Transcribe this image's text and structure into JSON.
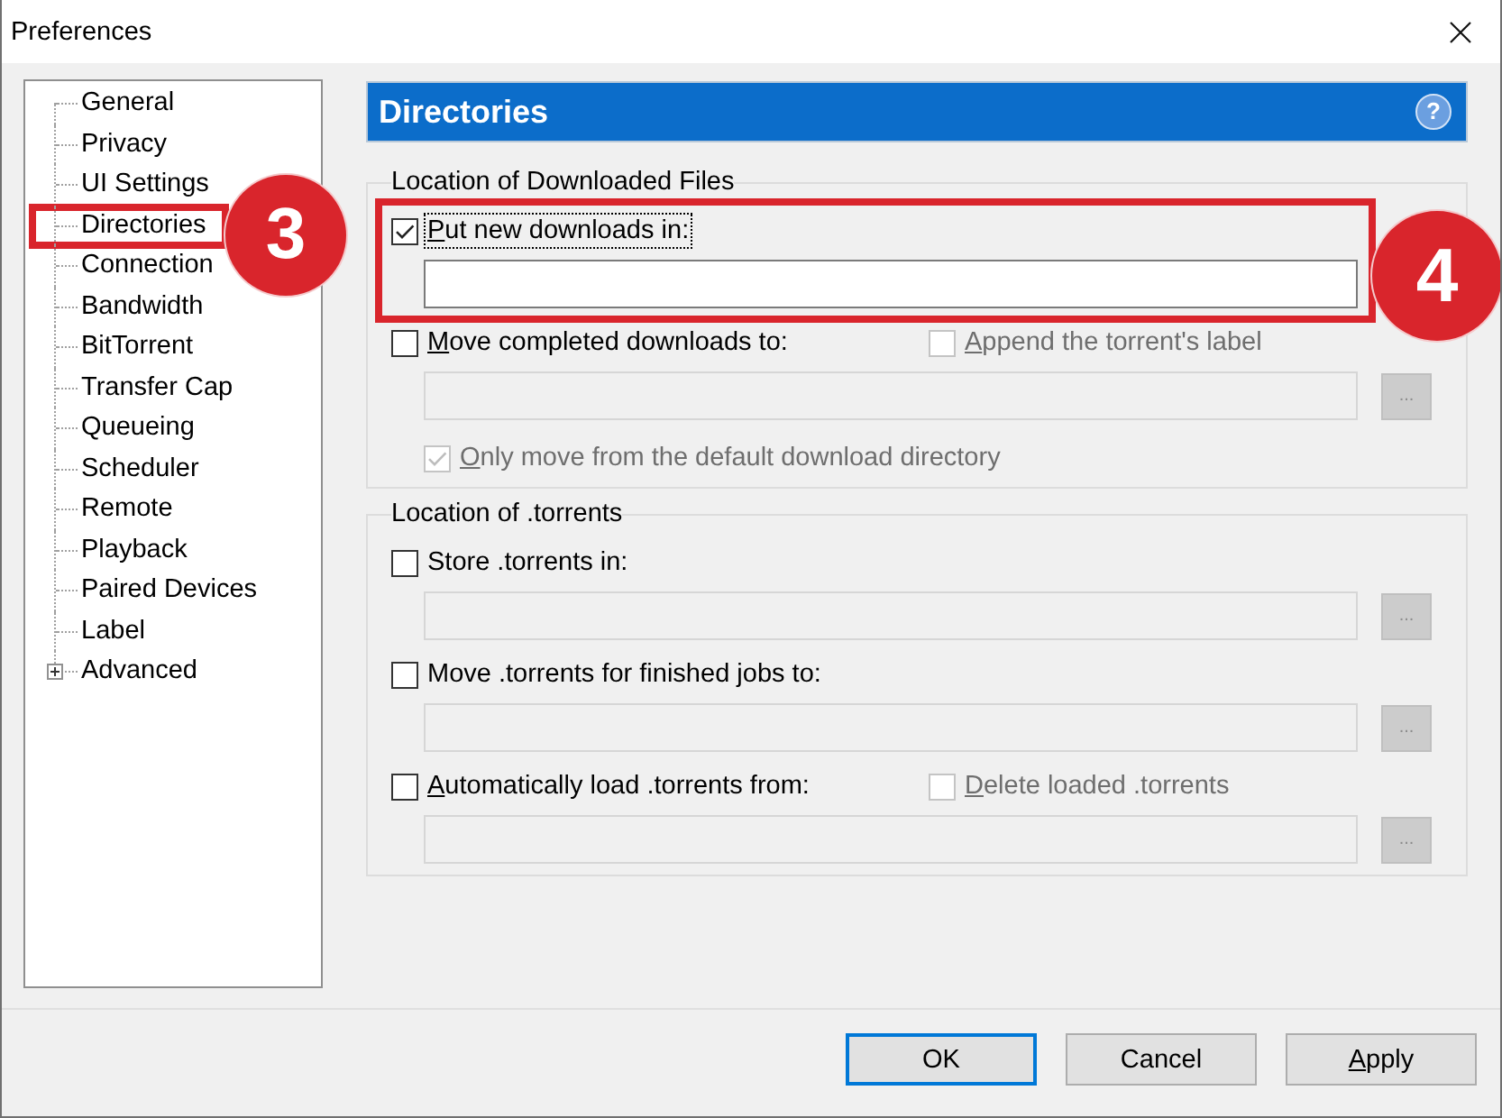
{
  "window": {
    "title": "Preferences"
  },
  "sidebar": {
    "items": [
      {
        "label": "General",
        "kind": "page",
        "selected": false
      },
      {
        "label": "Privacy",
        "kind": "page",
        "selected": false
      },
      {
        "label": "UI Settings",
        "kind": "page",
        "selected": false
      },
      {
        "label": "Directories",
        "kind": "page",
        "selected": false,
        "callout": "3"
      },
      {
        "label": "Connection",
        "kind": "page",
        "selected": false
      },
      {
        "label": "Bandwidth",
        "kind": "page",
        "selected": false
      },
      {
        "label": "BitTorrent",
        "kind": "page",
        "selected": false
      },
      {
        "label": "Transfer Cap",
        "kind": "page",
        "selected": false
      },
      {
        "label": "Queueing",
        "kind": "page",
        "selected": false
      },
      {
        "label": "Scheduler",
        "kind": "page",
        "selected": false
      },
      {
        "label": "Remote",
        "kind": "page",
        "selected": false
      },
      {
        "label": "Playback",
        "kind": "page",
        "selected": false
      },
      {
        "label": "Paired Devices",
        "kind": "page",
        "selected": false
      },
      {
        "label": "Label",
        "kind": "page",
        "selected": false
      },
      {
        "label": "Advanced",
        "kind": "branch",
        "selected": false,
        "expanded": false
      }
    ]
  },
  "section": {
    "title": "Directories",
    "help": "?"
  },
  "groups": [
    {
      "legend": "Location of Downloaded Files",
      "options": [
        {
          "kind": "path-option",
          "label": "Put new downloads in:",
          "checked": true,
          "disabled": false,
          "focused": true,
          "mnemonic": true,
          "callout": "4",
          "field": {
            "disabled": false
          }
        },
        {
          "kind": "path-option",
          "label": "Move completed downloads to:",
          "checked": false,
          "disabled": false,
          "focused": false,
          "mnemonic": true,
          "extra": {
            "label": "Append the torrent's label",
            "checked": false,
            "disabled": true,
            "mnemonic": true
          },
          "field": {
            "disabled": true,
            "browse": {
              "label": "...",
              "disabled": true
            }
          }
        },
        {
          "kind": "sub-option",
          "label": "Only move from the default download directory",
          "checked": true,
          "disabled": true,
          "focused": false,
          "mnemonic": true
        }
      ]
    },
    {
      "legend": "Location of .torrents",
      "options": [
        {
          "kind": "path-option",
          "label": "Store .torrents in:",
          "checked": false,
          "disabled": false,
          "focused": false,
          "mnemonic": false,
          "field": {
            "disabled": true,
            "browse": {
              "label": "...",
              "disabled": true
            }
          }
        },
        {
          "kind": "path-option",
          "label": "Move .torrents for finished jobs to:",
          "checked": false,
          "disabled": false,
          "focused": false,
          "mnemonic": false,
          "field": {
            "disabled": true,
            "browse": {
              "label": "...",
              "disabled": true
            }
          }
        },
        {
          "kind": "path-option",
          "label": "Automatically load .torrents from:",
          "checked": false,
          "disabled": false,
          "focused": false,
          "mnemonic": true,
          "extra": {
            "label": "Delete loaded .torrents",
            "checked": false,
            "disabled": true,
            "mnemonic": true
          },
          "field": {
            "disabled": true,
            "browse": {
              "label": "...",
              "disabled": true
            }
          }
        }
      ]
    }
  ],
  "buttons": [
    {
      "label": "OK",
      "default": true,
      "mnemonic": false
    },
    {
      "label": "Cancel",
      "default": false,
      "mnemonic": false
    },
    {
      "label": "Apply",
      "default": false,
      "mnemonic": true
    }
  ]
}
